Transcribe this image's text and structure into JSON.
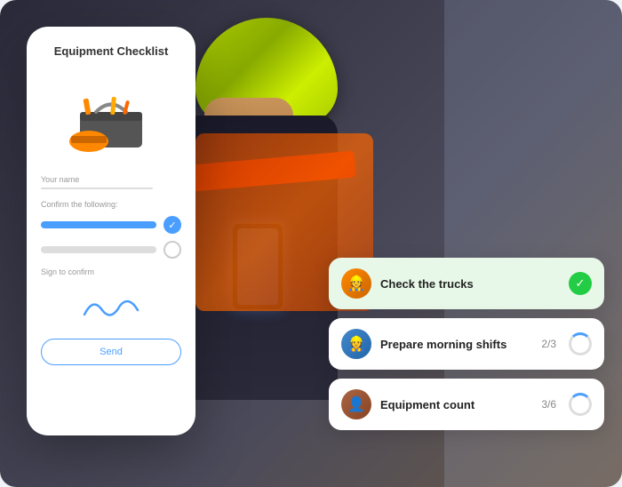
{
  "scene": {
    "background_color": "#3a3a4a"
  },
  "phone_card": {
    "title": "Equipment Checklist",
    "your_name_label": "Your name",
    "confirm_label": "Confirm the following:",
    "sign_label": "Sign to confirm",
    "send_button_label": "Send",
    "items": [
      {
        "checked": true
      },
      {
        "checked": false
      }
    ]
  },
  "task_cards": [
    {
      "label": "Check the trucks",
      "avatar_emoji": "👷",
      "avatar_color": "orange",
      "status": "completed",
      "progress": null
    },
    {
      "label": "Prepare morning shifts",
      "avatar_emoji": "👷",
      "avatar_color": "blue",
      "status": "in_progress",
      "progress": "2/3"
    },
    {
      "label": "Equipment count",
      "avatar_emoji": "👤",
      "avatar_color": "brown",
      "status": "in_progress",
      "progress": "3/6"
    }
  ]
}
